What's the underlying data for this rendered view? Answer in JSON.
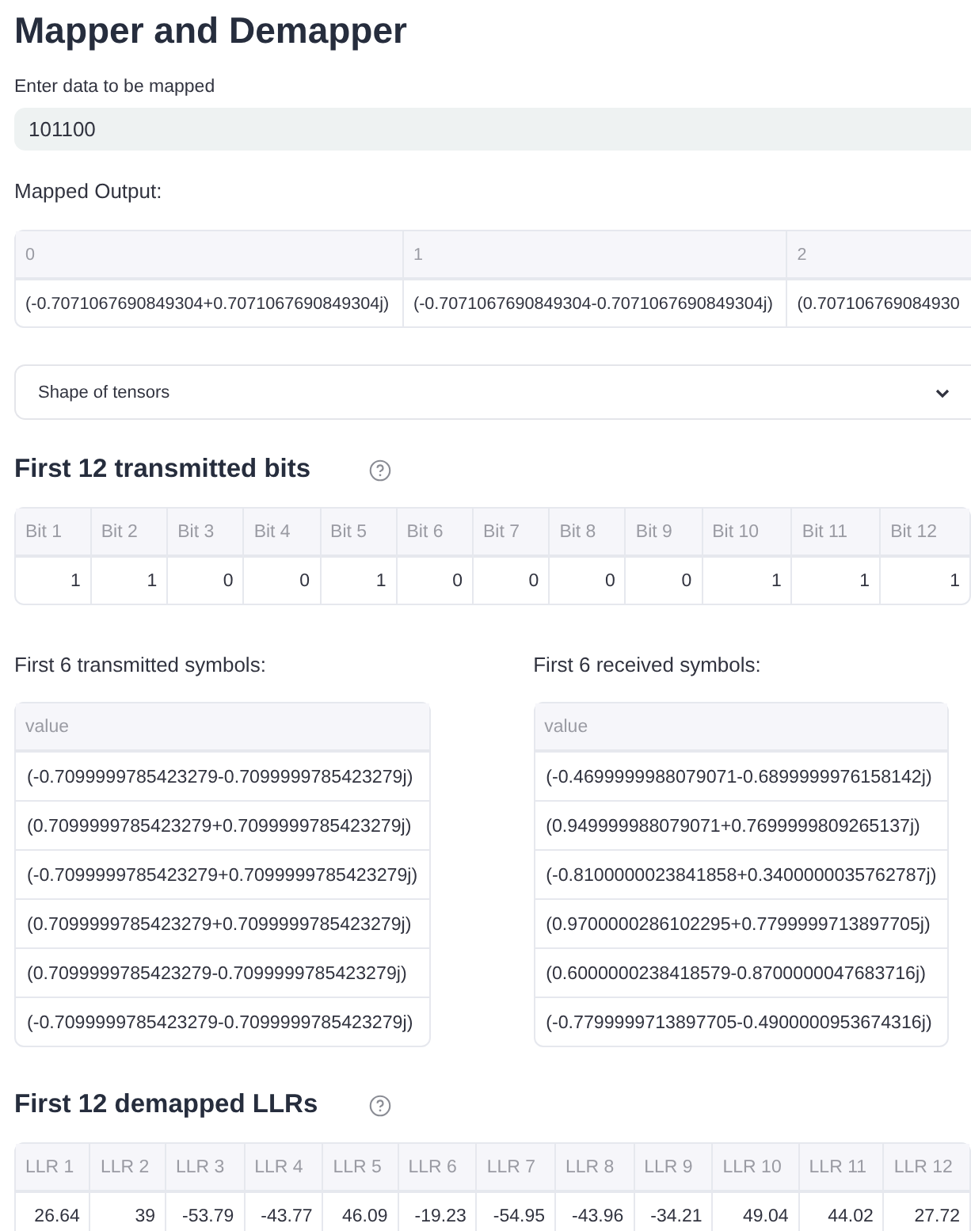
{
  "title": "Mapper and Demapper",
  "input": {
    "label": "Enter data to be mapped",
    "value": "101100"
  },
  "mapped_output": {
    "label": "Mapped Output:",
    "columns": [
      "0",
      "1",
      "2"
    ],
    "rows": [
      [
        "(-0.7071067690849304+0.7071067690849304j)",
        "(-0.7071067690849304-0.7071067690849304j)",
        "(0.707106769084930"
      ]
    ]
  },
  "expander": {
    "label": "Shape of tensors",
    "expanded": false
  },
  "bits": {
    "heading": "First 12 transmitted bits",
    "columns": [
      "Bit 1",
      "Bit 2",
      "Bit 3",
      "Bit 4",
      "Bit 5",
      "Bit 6",
      "Bit 7",
      "Bit 8",
      "Bit 9",
      "Bit 10",
      "Bit 11",
      "Bit 12"
    ],
    "rows": [
      [
        "1",
        "1",
        "0",
        "0",
        "1",
        "0",
        "0",
        "0",
        "0",
        "1",
        "1",
        "1"
      ]
    ]
  },
  "symbol_tables": [
    {
      "label": "First 6 transmitted symbols:",
      "column": "value",
      "rows": [
        "(-0.7099999785423279-0.7099999785423279j)",
        "(0.7099999785423279+0.7099999785423279j)",
        "(-0.7099999785423279+0.7099999785423279j)",
        "(0.7099999785423279+0.7099999785423279j)",
        "(0.7099999785423279-0.7099999785423279j)",
        "(-0.7099999785423279-0.7099999785423279j)"
      ]
    },
    {
      "label": "First 6 received symbols:",
      "column": "value",
      "rows": [
        "(-0.4699999988079071-0.6899999976158142j)",
        "(0.949999988079071+0.7699999809265137j)",
        "(-0.8100000023841858+0.3400000035762787j)",
        "(0.9700000286102295+0.7799999713897705j)",
        "(0.6000000238418579-0.8700000047683716j)",
        "(-0.7799999713897705-0.4900000953674316j)"
      ]
    }
  ],
  "llrs": {
    "heading": "First 12 demapped LLRs",
    "columns": [
      "LLR 1",
      "LLR 2",
      "LLR 3",
      "LLR 4",
      "LLR 5",
      "LLR 6",
      "LLR 7",
      "LLR 8",
      "LLR 9",
      "LLR 10",
      "LLR 11",
      "LLR 12"
    ],
    "rows": [
      [
        "26.64",
        "39",
        "-53.79",
        "-43.77",
        "46.09",
        "-19.23",
        "-54.95",
        "-43.96",
        "-34.21",
        "49.04",
        "44.02",
        "27.72"
      ]
    ]
  }
}
